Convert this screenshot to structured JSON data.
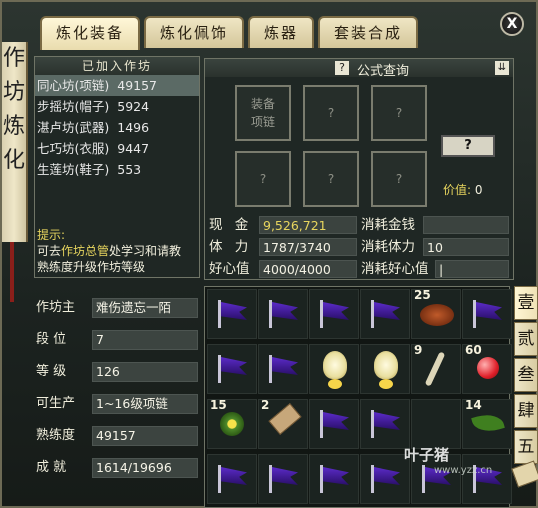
{
  "tabs": [
    {
      "label": "炼化装备",
      "active": true
    },
    {
      "label": "炼化佩饰",
      "active": false
    },
    {
      "label": "炼器",
      "active": false
    },
    {
      "label": "套装合成",
      "active": false
    }
  ],
  "close_label": "X",
  "banner_text": [
    "作",
    "坊",
    "炼",
    "化"
  ],
  "workshop": {
    "header": "已加入作坊",
    "items": [
      {
        "label": "同心坊(项链)",
        "value": "49157"
      },
      {
        "label": "步摇坊(帽子)",
        "value": "5924"
      },
      {
        "label": "湛卢坊(武器)",
        "value": "1496"
      },
      {
        "label": "七巧坊(衣服)",
        "value": "9447"
      },
      {
        "label": "生莲坊(鞋子)",
        "value": "553"
      }
    ],
    "tip_title": "提示:",
    "tip_line1_pre": "可去",
    "tip_link": "作坊总管",
    "tip_line1_post": "处学习和请教",
    "tip_line2": "熟练度升级作坊等级"
  },
  "formula": {
    "help_icon": "?",
    "title": "公式查询",
    "toggle_icon": "chevron-down-icon",
    "main_slot": [
      "装备",
      "项链"
    ],
    "empty_slot": "?",
    "query_button": "?",
    "price_label": "价值:",
    "price_value": "0"
  },
  "resources": {
    "money_label": "现 金",
    "money_value": "9,526,721",
    "money_cost_label": "消耗金钱",
    "money_cost_value": "",
    "stamina_label": "体 力",
    "stamina_value": "1787/3740",
    "stamina_cost_label": "消耗体力",
    "stamina_cost_value": "10",
    "favor_label": "好心值",
    "favor_value": "4000/4000",
    "favor_cost_label": "消耗好心值",
    "favor_cost_value": "|"
  },
  "attributes": [
    {
      "label": "作坊主",
      "value": "难伤遗忘一陌"
    },
    {
      "label": "段  位",
      "value": "7"
    },
    {
      "label": "等  级",
      "value": "126"
    },
    {
      "label": "可生产",
      "value": "1~16级项链"
    },
    {
      "label": "熟练度",
      "value": "49157"
    },
    {
      "label": "成  就",
      "value": "1614/19696"
    }
  ],
  "inventory": [
    [
      "purple-flag-icon",
      "",
      "purple-flag-icon",
      "",
      "purple-flag-icon",
      "",
      "purple-flag-icon",
      "",
      "fire-stone-icon",
      "25",
      "purple-flag-icon",
      ""
    ],
    [
      "purple-flag-icon",
      "",
      "purple-flag-icon",
      "",
      "lantern-icon",
      "",
      "lantern-icon",
      "",
      "bone-twig-icon",
      "9",
      "red-orb-icon",
      "60"
    ],
    [
      "flower-icon",
      "15",
      "wooden-tag-icon",
      "2",
      "purple-flag-icon",
      "",
      "purple-flag-icon",
      "",
      "empty",
      "",
      "leaf-icon",
      "14"
    ],
    [
      "purple-flag-icon",
      "",
      "purple-flag-icon",
      "",
      "purple-flag-icon",
      "",
      "purple-flag-icon",
      "",
      "purple-flag-icon",
      "",
      "purple-flag-icon",
      ""
    ]
  ],
  "page_tabs": [
    "壹",
    "贰",
    "叁",
    "肆",
    "五"
  ],
  "watermark": "叶子猪",
  "watermark_url": "www.yzz.cn"
}
